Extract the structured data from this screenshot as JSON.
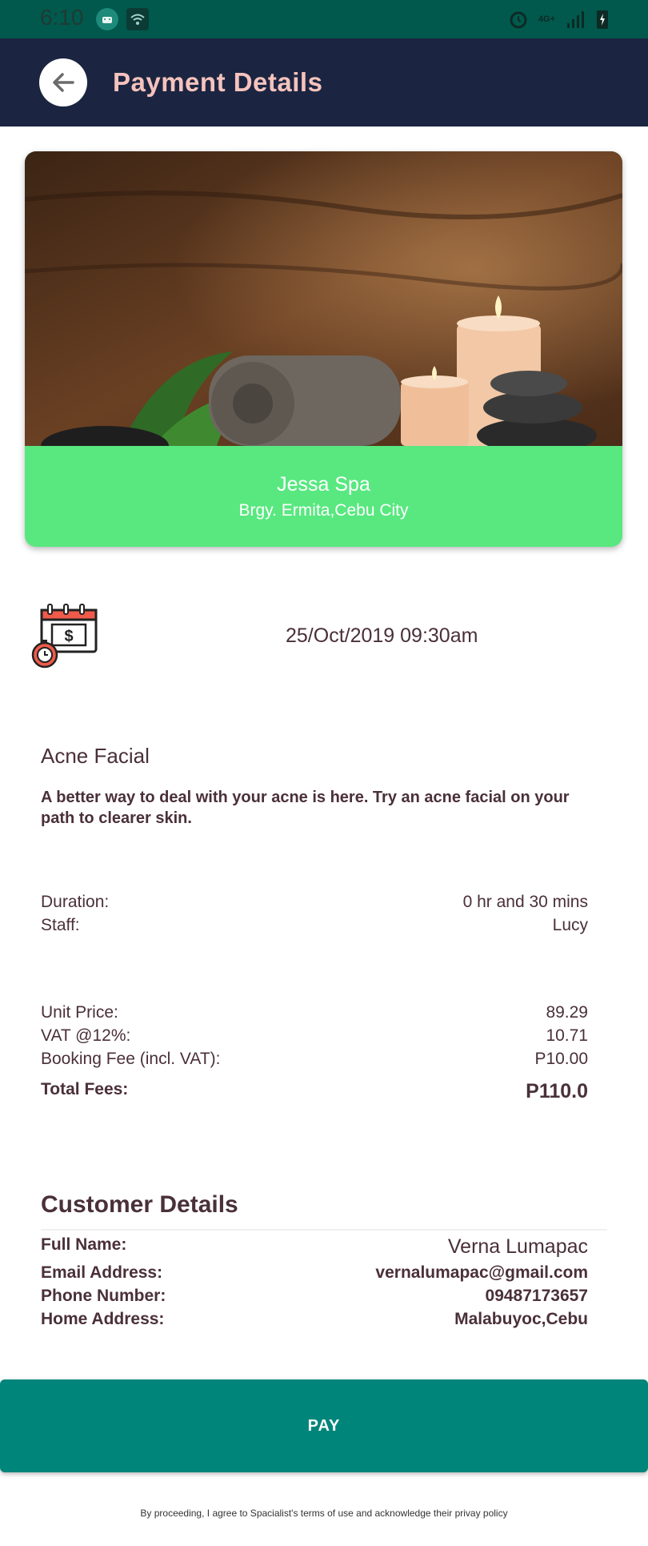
{
  "status_bar": {
    "time": "6:10",
    "network": "4G+"
  },
  "app_bar": {
    "title": "Payment Details",
    "back_icon": "arrow-left-icon"
  },
  "spa": {
    "name": "Jessa Spa",
    "address": "Brgy. Ermita,Cebu City"
  },
  "appointment": {
    "datetime": "25/Oct/2019 09:30am",
    "icon": "calendar-payment-icon"
  },
  "service": {
    "name": "Acne Facial",
    "description": "A better way to deal with your acne is here. Try an acne facial on your path to clearer skin."
  },
  "details": {
    "duration_label": "Duration:",
    "duration_value": "0 hr and 30 mins",
    "staff_label": "Staff:",
    "staff_value": "Lucy"
  },
  "fees": {
    "unit_price_label": "Unit Price:",
    "unit_price_value": "89.29",
    "vat_label": "VAT @12%:",
    "vat_value": "10.71",
    "booking_fee_label": "Booking Fee (incl. VAT):",
    "booking_fee_value": "P10.00",
    "total_label": "Total Fees:",
    "total_value": "P110.0"
  },
  "customer": {
    "section_title": "Customer Details",
    "full_name_label": "Full Name:",
    "full_name_value": "Verna Lumapac",
    "email_label": "Email Address:",
    "email_value": "vernalumapac@gmail.com",
    "phone_label": "Phone Number:",
    "phone_value": "09487173657",
    "address_label": "Home Address:",
    "address_value": "Malabuyoc,Cebu"
  },
  "actions": {
    "pay_label": "PAY"
  },
  "disclaimer": "By proceeding, I agree to Spacialist's terms of use and acknowledge their privay policy",
  "colors": {
    "status_bar": "#00594c",
    "app_bar": "#1b2541",
    "title_text": "#f5c3bd",
    "card_footer": "#58e87f",
    "pay_button": "#00857a",
    "body_text": "#4a3038"
  }
}
